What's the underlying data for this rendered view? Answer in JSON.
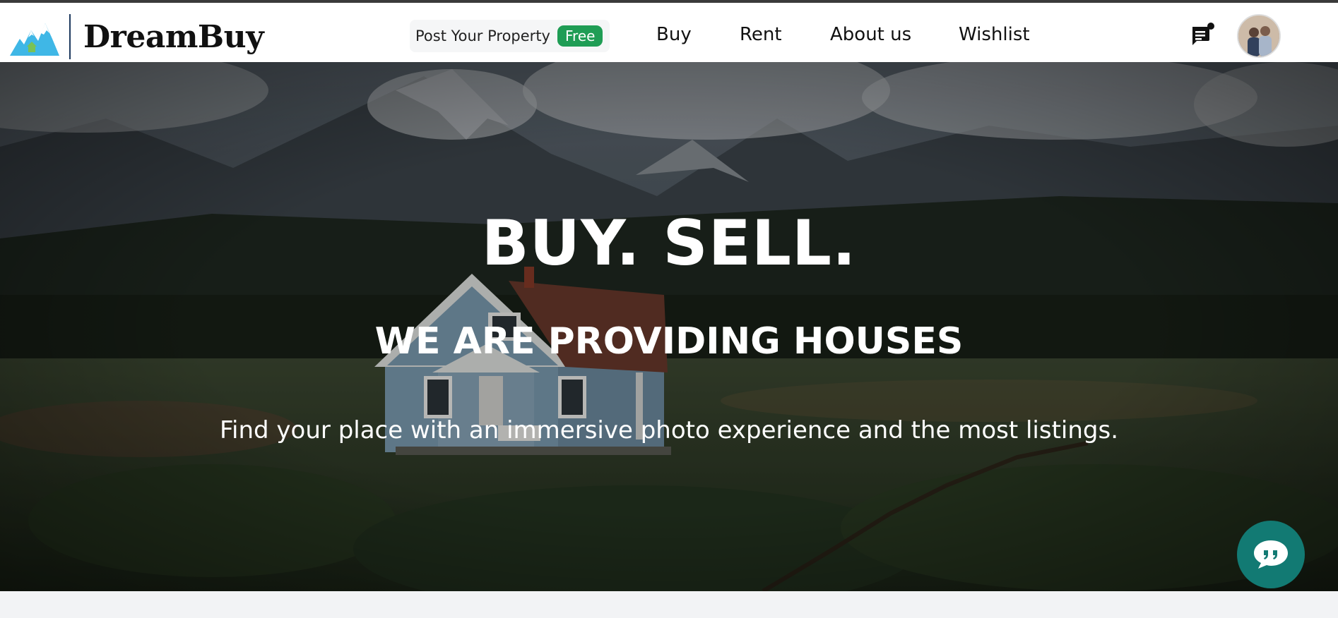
{
  "header": {
    "brand": "DreamBuy",
    "post_property": {
      "label": "Post Your Property",
      "badge": "Free",
      "badge_color": "#1f9d55"
    },
    "nav": [
      {
        "label": "Buy"
      },
      {
        "label": "Rent"
      },
      {
        "label": "About us"
      },
      {
        "label": "Wishlist"
      }
    ],
    "icons": {
      "messages": "chat-notification-icon",
      "avatar": "user-avatar"
    }
  },
  "hero": {
    "title": "BUY. SELL.",
    "subtitle": "WE ARE PROVIDING HOUSES",
    "description": "Find your place with an immersive photo experience and the most listings."
  },
  "chat_widget": {
    "icon": "quote-chat-icon",
    "color": "#127a73"
  }
}
